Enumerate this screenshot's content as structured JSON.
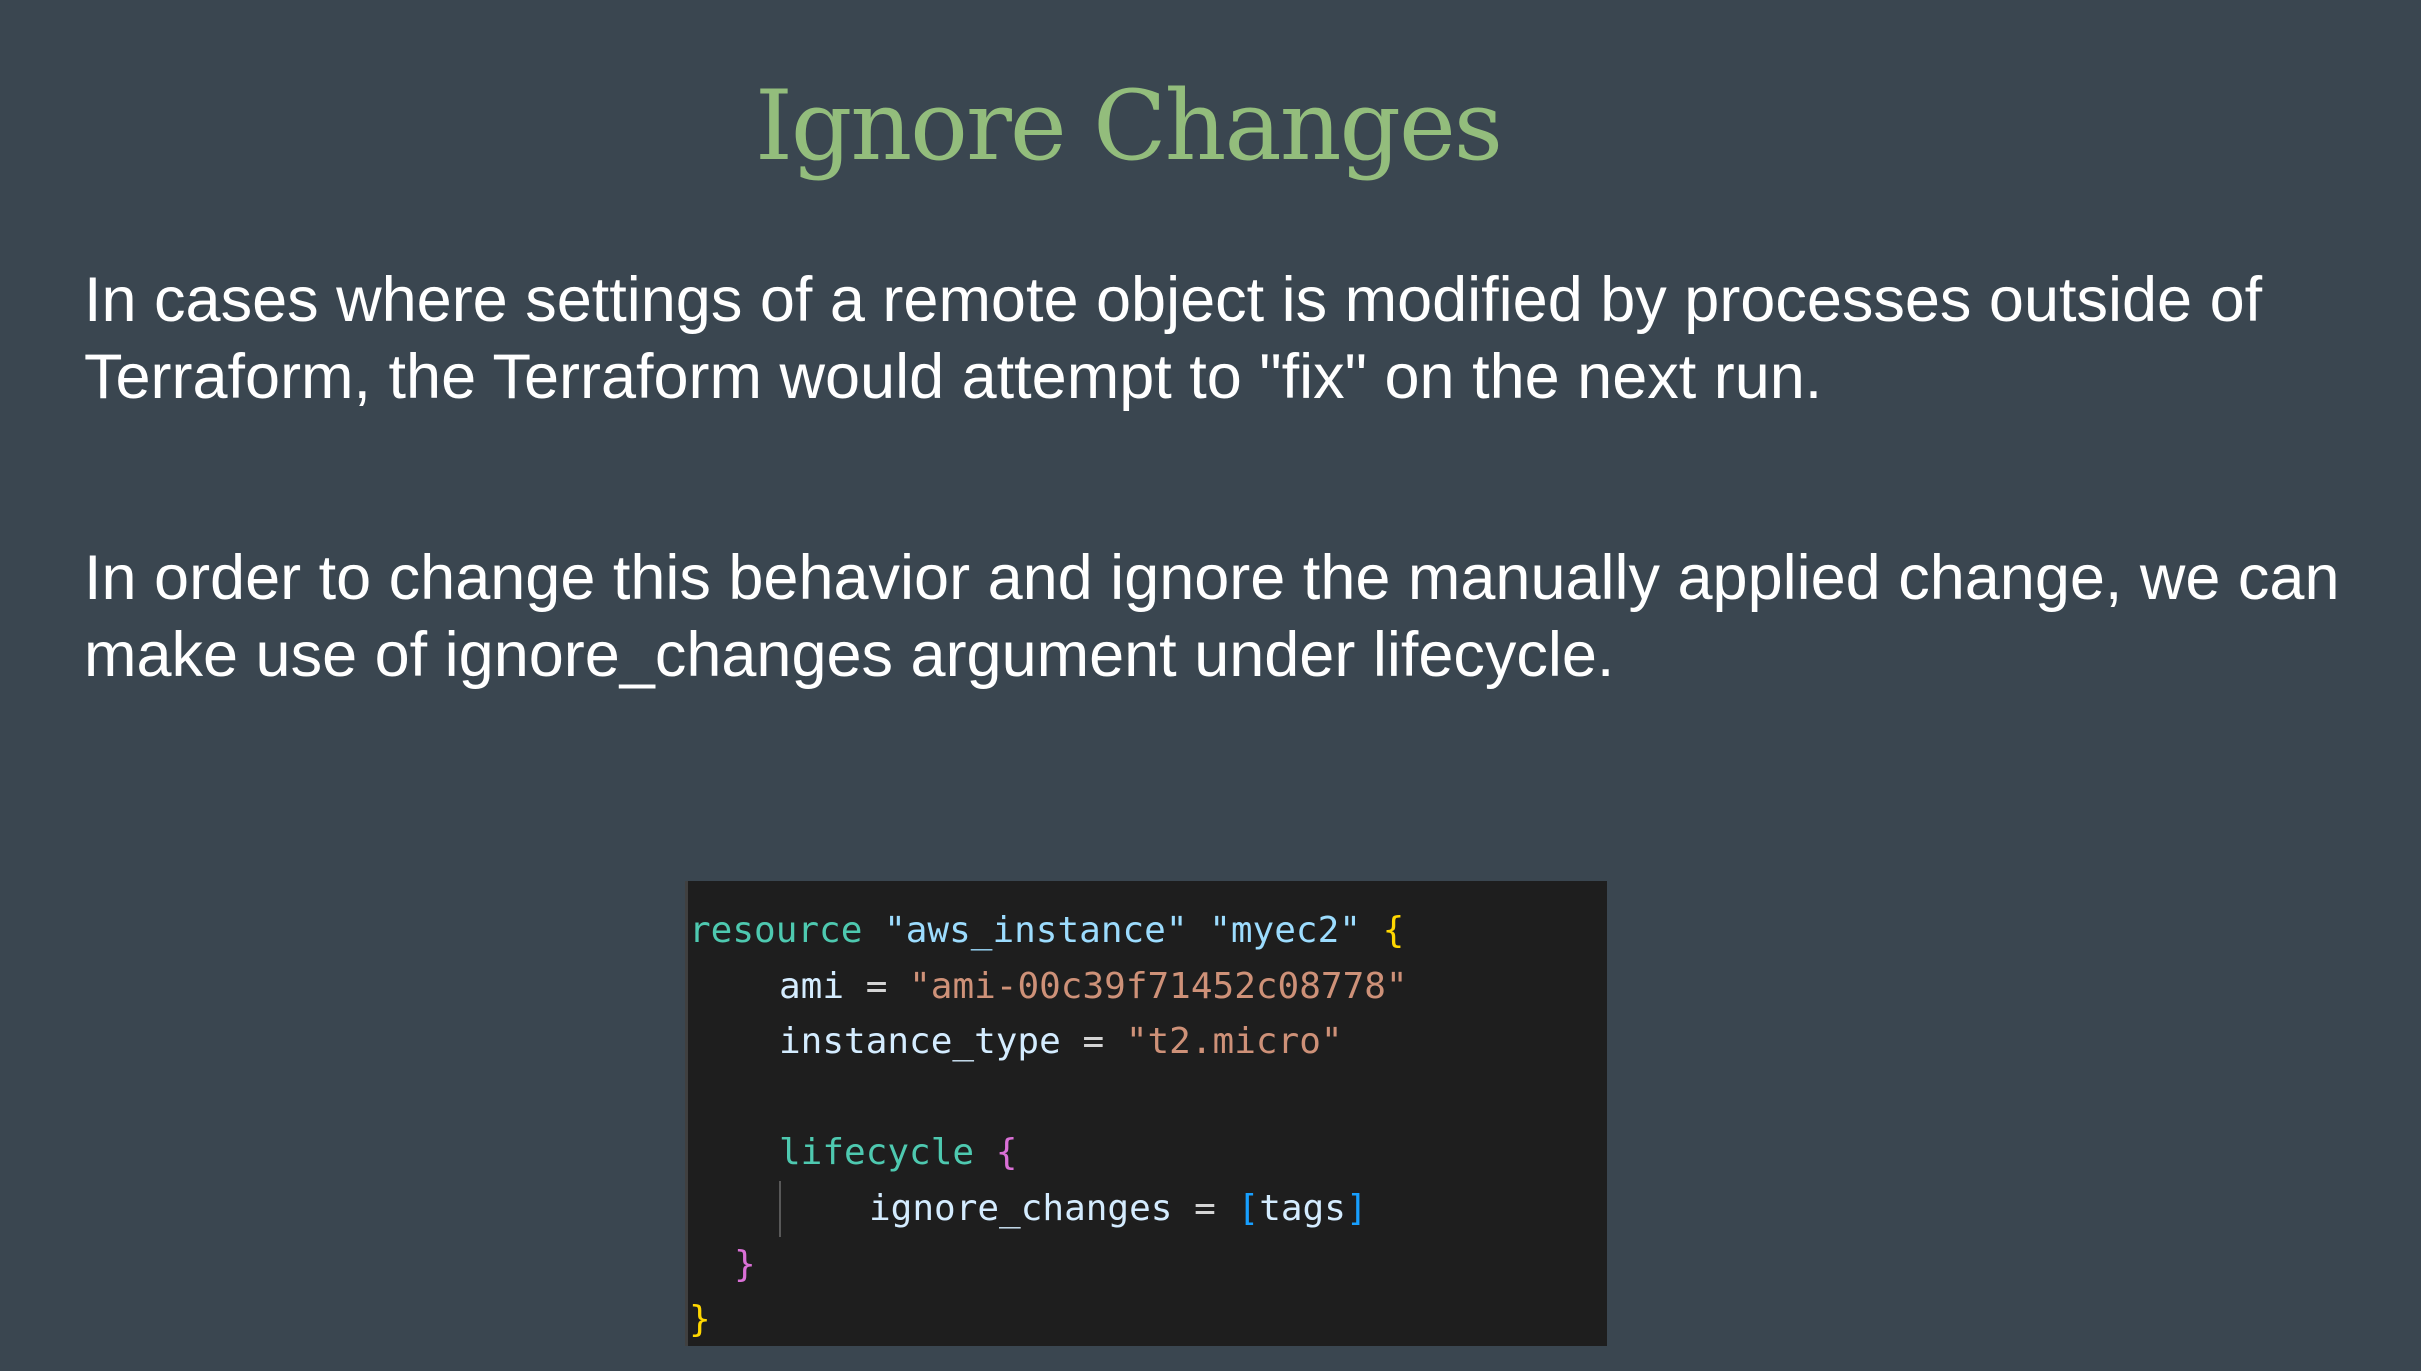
{
  "title": "Ignore Changes",
  "paragraph_1": "In cases where settings of a remote object is modified by processes outside of Terraform, the Terraform would attempt to \"fix\" on the next run.",
  "paragraph_2": "In order to change this behavior and ignore the manually applied change, we can make use of ignore_changes argument under lifecycle.",
  "code": {
    "resource_kw": "resource",
    "resource_type": "\"aws_instance\"",
    "resource_name": "\"myec2\"",
    "open_brace": "{",
    "ami_key": "ami",
    "ami_value": "\"ami-00c39f71452c08778\"",
    "instance_type_key": "instance_type",
    "instance_type_value": "\"t2.micro\"",
    "lifecycle_kw": "lifecycle",
    "lifecycle_open": "{",
    "ignore_changes_key": "ignore_changes",
    "equals": "=",
    "list_open": "[",
    "list_value": "tags",
    "list_close": "]",
    "lifecycle_close": "}",
    "close_brace": "}"
  },
  "colors": {
    "background": "#3a4650",
    "title": "#93bd7c",
    "code_background": "#1e1e1e"
  }
}
